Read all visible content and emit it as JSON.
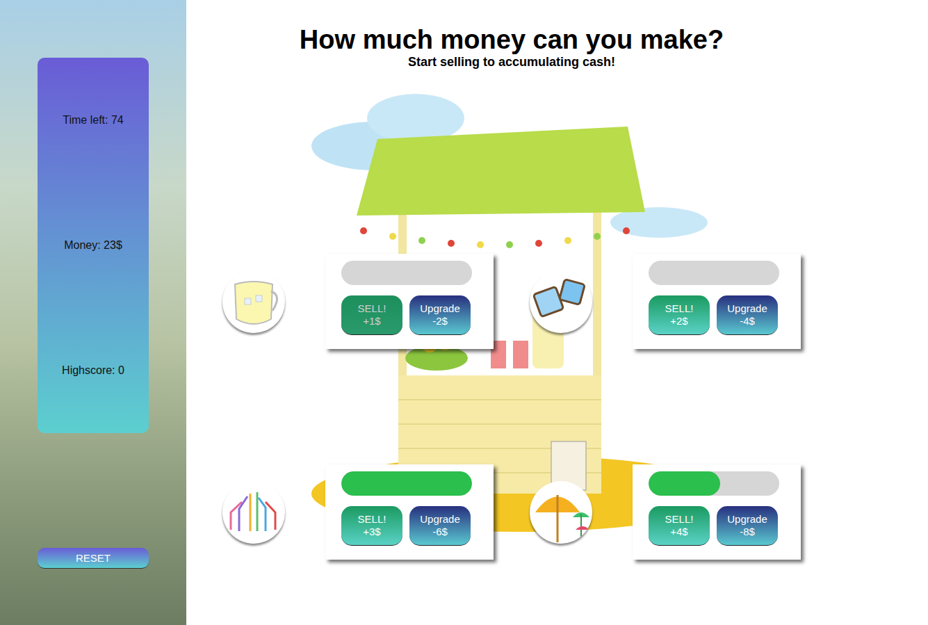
{
  "title": "How much money can you make?",
  "subtitle": "Start selling to accumulating cash!",
  "stats": [
    "Time left: 74",
    "Money: 23$",
    "Highscore: 0"
  ],
  "reset_button": "RESET",
  "items": [
    {
      "kind": "pitcher",
      "level": 0,
      "pressed": true,
      "sell_label": "SELL!",
      "sell_amount": "+1$",
      "upgrade_label": "Upgrade",
      "upgrade_cost": "-2$"
    },
    {
      "kind": "ice",
      "level": 0,
      "pressed": false,
      "sell_label": "SELL!",
      "sell_amount": "+2$",
      "upgrade_label": "Upgrade",
      "upgrade_cost": "-4$"
    },
    {
      "kind": "straws",
      "level": 1,
      "pressed": false,
      "sell_label": "SELL!",
      "sell_amount": "+3$",
      "upgrade_label": "Upgrade",
      "upgrade_cost": "-6$"
    },
    {
      "kind": "umbrella",
      "level": 0.55,
      "pressed": false,
      "sell_label": "SELL!",
      "sell_amount": "+4$",
      "upgrade_label": "Upgrade",
      "upgrade_cost": "-8$"
    }
  ]
}
